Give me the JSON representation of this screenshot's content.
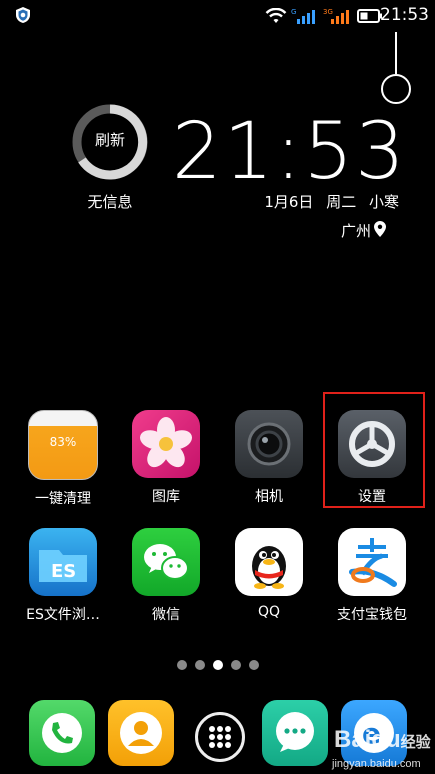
{
  "status_bar": {
    "time": "21:53",
    "net_tag_1": "G",
    "net_tag_2": "3G"
  },
  "weather_widget": {
    "refresh_label": "刷新",
    "info_text": "无信息"
  },
  "clock_widget": {
    "time": "21:53",
    "date": "1月6日",
    "weekday": "周二",
    "solar_term": "小寒",
    "city": "广州"
  },
  "apps": [
    {
      "label": "一键清理",
      "icon": "cleanup-icon",
      "badge": "83%"
    },
    {
      "label": "图库",
      "icon": "gallery-flower-icon"
    },
    {
      "label": "相机",
      "icon": "camera-icon"
    },
    {
      "label": "设置",
      "icon": "settings-gear-icon"
    },
    {
      "label": "ES文件浏…",
      "icon": "es-file-explorer-icon"
    },
    {
      "label": "微信",
      "icon": "wechat-icon"
    },
    {
      "label": "QQ",
      "icon": "qq-penguin-icon"
    },
    {
      "label": "支付宝钱包",
      "icon": "alipay-icon"
    }
  ],
  "page_indicator": {
    "count": 5,
    "active_index": 2
  },
  "dock": [
    {
      "icon": "phone-icon"
    },
    {
      "icon": "contacts-icon"
    },
    {
      "icon": "app-drawer-icon"
    },
    {
      "icon": "messages-icon"
    },
    {
      "icon": "browser-icon"
    }
  ],
  "watermark": {
    "logo": "Baidu",
    "suffix": "经验",
    "url": "jingyan.baidu.com"
  },
  "colors": {
    "highlight": "#e0211a",
    "background": "#000000"
  }
}
